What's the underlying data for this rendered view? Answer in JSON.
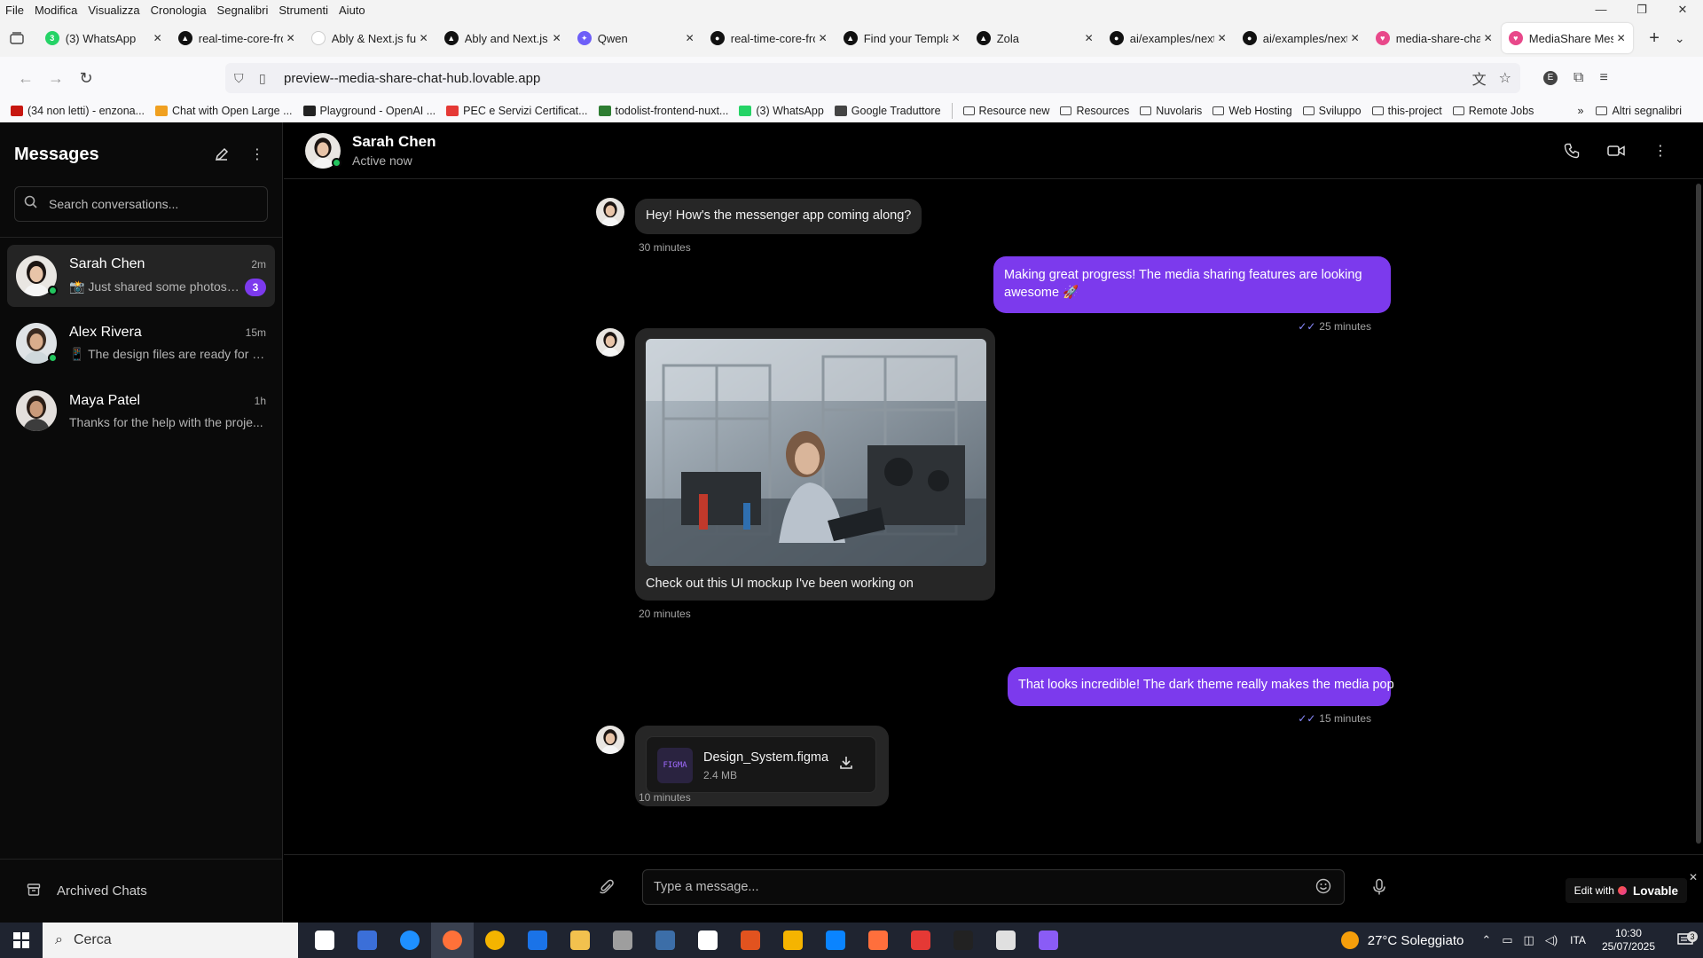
{
  "menubar": {
    "items": [
      "File",
      "Modifica",
      "Visualizza",
      "Cronologia",
      "Segnalibri",
      "Strumenti",
      "Aiuto"
    ]
  },
  "tabs": [
    {
      "title": "(3) WhatsApp",
      "color": "#25d366",
      "glyph": "3",
      "active": false
    },
    {
      "title": "real-time-core-fro",
      "color": "#111111",
      "glyph": "▲",
      "active": false
    },
    {
      "title": "Ably & Next.js fundar",
      "color": "#ffffff",
      "glyph": "",
      "active": false
    },
    {
      "title": "Ably and Next.js S",
      "color": "#111111",
      "glyph": "▲",
      "active": false
    },
    {
      "title": "Qwen",
      "color": "#6d5ef8",
      "glyph": "✦",
      "active": false
    },
    {
      "title": "real-time-core-fro",
      "color": "#111111",
      "glyph": "●",
      "active": false
    },
    {
      "title": "Find your Templat",
      "color": "#111111",
      "glyph": "▲",
      "active": false
    },
    {
      "title": "Zola",
      "color": "#111111",
      "glyph": "▲",
      "active": false
    },
    {
      "title": "ai/examples/next",
      "color": "#111111",
      "glyph": "●",
      "active": false
    },
    {
      "title": "ai/examples/next",
      "color": "#111111",
      "glyph": "●",
      "active": false
    },
    {
      "title": "media-share-chat",
      "color": "#e8488a",
      "glyph": "♥",
      "active": false
    },
    {
      "title": "MediaShare Mes:",
      "color": "#e8488a",
      "glyph": "♥",
      "active": true
    }
  ],
  "browser": {
    "url": "preview--media-share-chat-hub.lovable.app"
  },
  "bookmarks": [
    {
      "label": "(34 non letti) - enzona...",
      "color": "#c71610"
    },
    {
      "label": "Chat with Open Large ...",
      "color": "#f0a020"
    },
    {
      "label": "Playground - OpenAI ...",
      "color": "#222222"
    },
    {
      "label": "PEC e Servizi Certificat...",
      "color": "#e53935"
    },
    {
      "label": "todolist-frontend-nuxt...",
      "color": "#2e7d32"
    },
    {
      "label": "(3) WhatsApp",
      "color": "#25d366"
    },
    {
      "label": "Google Traduttore",
      "color": "#444444"
    }
  ],
  "bookmark_folders": [
    "Resource new",
    "Resources",
    "Nuvolaris",
    "Web Hosting",
    "Sviluppo",
    "this-project",
    "Remote Jobs"
  ],
  "bookmarks_other": "Altri segnalibri",
  "sidebar": {
    "title": "Messages",
    "search_placeholder": "Search conversations...",
    "conversations": [
      {
        "name": "Sarah Chen",
        "time": "2m",
        "preview": "📸 Just shared some photos ...",
        "unread": "3",
        "online": true,
        "active": true
      },
      {
        "name": "Alex Rivera",
        "time": "15m",
        "preview": "📱 The design files are ready for re...",
        "unread": "",
        "online": true,
        "active": false
      },
      {
        "name": "Maya Patel",
        "time": "1h",
        "preview": "Thanks for the help with the proje...",
        "unread": "",
        "online": false,
        "active": false
      }
    ],
    "archived_label": "Archived Chats"
  },
  "chat": {
    "contact_name": "Sarah Chen",
    "contact_status": "Active now",
    "messages": [
      {
        "direction": "in",
        "type": "text",
        "text": "Hey! How's the messenger app coming along?",
        "time": "30 minutes"
      },
      {
        "direction": "out",
        "type": "text",
        "text": "Making great progress! The media sharing features are looking awesome 🚀",
        "time": "25 minutes"
      },
      {
        "direction": "in",
        "type": "image",
        "caption": "Check out this UI mockup I've been working on",
        "time": "20 minutes"
      },
      {
        "direction": "out",
        "type": "text",
        "text": "That looks incredible! The dark theme really makes the media pop",
        "time": "15 minutes"
      },
      {
        "direction": "in",
        "type": "file",
        "file_name": "Design_System.figma",
        "file_size": "2.4 MB",
        "file_badge": "FIGMA",
        "time": "10 minutes"
      }
    ],
    "input_placeholder": "Type a message...",
    "edit_with": "Edit with",
    "brand": "Lovable"
  },
  "taskbar": {
    "search_label": "Cerca",
    "weather": "27°C  Soleggiato",
    "lang": "ITA",
    "time": "10:30",
    "date": "25/07/2025",
    "notifications": "3"
  },
  "colors": {
    "accent": "#7c3aed",
    "online": "#22c55e",
    "bubble_in": "#262626",
    "background": "#000000"
  }
}
